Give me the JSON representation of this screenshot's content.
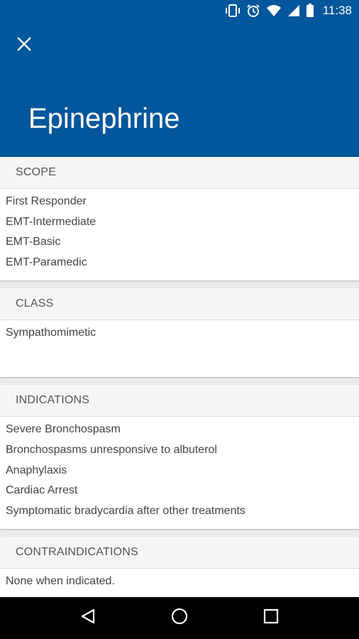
{
  "status_bar": {
    "time": "11:38",
    "icons": [
      "vibrate-icon",
      "alarm-icon",
      "wifi-icon",
      "cell-signal-icon",
      "battery-icon"
    ]
  },
  "header": {
    "title": "Epinephrine",
    "close_icon": "close-icon",
    "background_color": "#01579b"
  },
  "sections": [
    {
      "heading": "SCOPE",
      "items": [
        "First Responder",
        "EMT-Intermediate",
        "EMT-Basic",
        "EMT-Paramedic"
      ]
    },
    {
      "heading": "CLASS",
      "items": [
        "Sympathomimetic"
      ]
    },
    {
      "heading": "INDICATIONS",
      "items": [
        "Severe Bronchospasm",
        "Bronchospasms unresponsive to albuterol",
        "Anaphylaxis",
        "Cardiac Arrest",
        "Symptomatic bradycardia after other treatments"
      ]
    },
    {
      "heading": "CONTRAINDICATIONS",
      "items": [
        "None when indicated."
      ]
    }
  ],
  "nav_bar": {
    "icons": [
      "back-icon",
      "home-icon",
      "recents-icon"
    ]
  }
}
